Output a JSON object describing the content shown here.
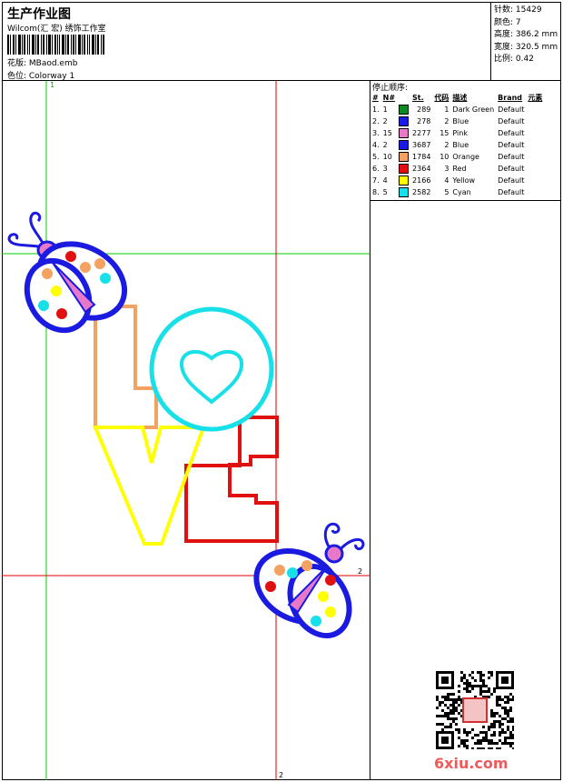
{
  "header": {
    "title": "生产作业图",
    "company": "Wilcom(汇 宏) 绣饰工作室",
    "design_label": "花版:  MBaod.emb",
    "colorway_label": "色位:  Colorway 1"
  },
  "stats": [
    {
      "label": "针数",
      "value": "15429"
    },
    {
      "label": "颜色",
      "value": "7"
    },
    {
      "label": "高度",
      "value": "386.2 mm"
    },
    {
      "label": "宽度",
      "value": "320.5 mm"
    },
    {
      "label": "比例",
      "value": "0.42"
    }
  ],
  "stop_sequence": {
    "title": "停止顺序:",
    "headers": [
      "#",
      "N#",
      "St.",
      "代码",
      "描述",
      "Brand",
      "元素"
    ],
    "rows": [
      {
        "idx": "1.",
        "n": "1",
        "st": "289",
        "code": "1",
        "desc": "Dark Green",
        "brand": "Default",
        "color": "#0a8a1f"
      },
      {
        "idx": "2.",
        "n": "2",
        "st": "278",
        "code": "2",
        "desc": "Blue",
        "brand": "Default",
        "color": "#1a1ae0"
      },
      {
        "idx": "3.",
        "n": "15",
        "st": "2277",
        "code": "15",
        "desc": "Pink",
        "brand": "Default",
        "color": "#e878c8"
      },
      {
        "idx": "4.",
        "n": "2",
        "st": "3687",
        "code": "2",
        "desc": "Blue",
        "brand": "Default",
        "color": "#1a1ae0"
      },
      {
        "idx": "5.",
        "n": "10",
        "st": "1784",
        "code": "10",
        "desc": "Orange",
        "brand": "Default",
        "color": "#f4a261"
      },
      {
        "idx": "6.",
        "n": "3",
        "st": "2364",
        "code": "3",
        "desc": "Red",
        "brand": "Default",
        "color": "#e01010"
      },
      {
        "idx": "7.",
        "n": "4",
        "st": "2166",
        "code": "4",
        "desc": "Yellow",
        "brand": "Default",
        "color": "#ffff00"
      },
      {
        "idx": "8.",
        "n": "5",
        "st": "2582",
        "code": "5",
        "desc": "Cyan",
        "brand": "Default",
        "color": "#18e0e8"
      }
    ]
  },
  "guides": {
    "green_label": "1",
    "red_label": "2",
    "green_color": "#00cc00",
    "red_color": "#e00000"
  },
  "artwork": {
    "letters": [
      "L",
      "O",
      "V",
      "E"
    ],
    "colors": {
      "blue": "#1a1ae0",
      "orange": "#f4a261",
      "cyan": "#18e0e8",
      "yellow": "#ffff00",
      "red": "#e01010",
      "pink": "#e878c8"
    }
  },
  "watermark": "6xiu.com"
}
